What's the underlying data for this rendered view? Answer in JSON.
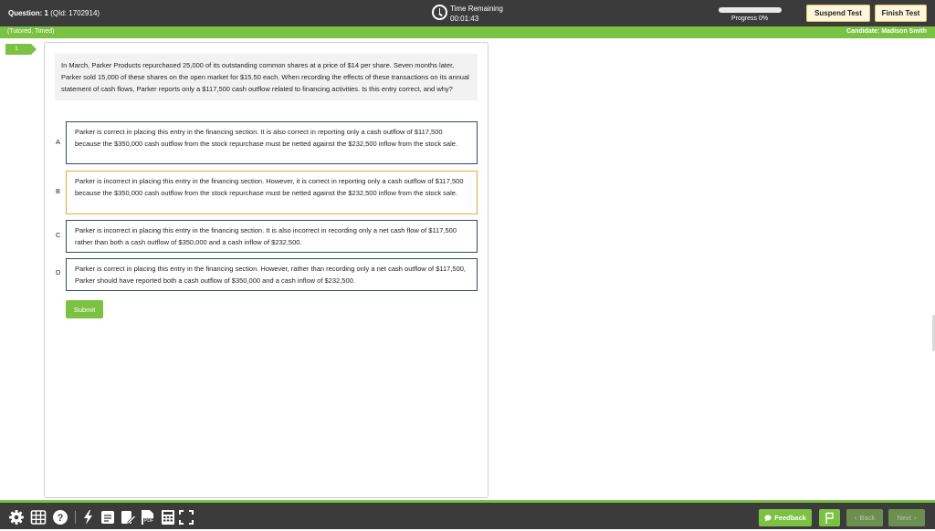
{
  "header": {
    "question_label": "Question: 1",
    "question_id": "(QId: 1702914)",
    "time_remaining_label": "Time Remaining",
    "time_remaining_value": "00:01:43",
    "progress_label": "Progress 0%",
    "progress_value": 0,
    "suspend_label": "Suspend Test",
    "finish_label": "Finish Test"
  },
  "subheader": {
    "mode": "(Tutored, Timed)",
    "candidate": "Candidate: Madison Smith"
  },
  "question_tab": "1",
  "question": {
    "stem": "In March, Parker Products repurchased 25,000 of its outstanding common shares at a price of $14 per share. Seven months later, Parker sold 15,000 of these shares on the open market for $15.50 each. When recording the effects of these transactions on its annual statement of cash flows, Parker reports only a $117,500 cash outflow related to financing activities. Is this entry correct, and why?",
    "choices": [
      {
        "letter": "A",
        "text": "Parker is correct in placing this entry in the financing section. It is also correct in reporting only a cash outflow of $117,500 because the $350,000 cash outflow from the stock repurchase must be netted against the $232,500 inflow from the stock sale."
      },
      {
        "letter": "B",
        "text": "Parker is incorrect in placing this entry in the financing section. However, it is correct in reporting only a cash outflow of $117,500 because the $350,000 cash outflow from the stock repurchase must be netted against the $232,500 inflow from the stock sale."
      },
      {
        "letter": "C",
        "text": "Parker is incorrect in placing this entry in the financing section. It is also incorrect in recording only a net cash flow of $117,500 rather than both a cash outflow of $350,000 and a cash inflow of $232,500."
      },
      {
        "letter": "D",
        "text": "Parker is correct in placing this entry in the financing section. However, rather than recording only a net cash outflow of $117,500, Parker should have reported both a cash outflow of $350,000 and a cash inflow of $232,500."
      }
    ],
    "submit_label": "Submit"
  },
  "footer": {
    "feedback_label": "Feedback",
    "back_label": "Back",
    "next_label": "Next",
    "pdf_label": "PDF"
  },
  "colors": {
    "accent": "#7cc242",
    "bar": "#3b3b3b",
    "selected_border": "#e8a938"
  }
}
